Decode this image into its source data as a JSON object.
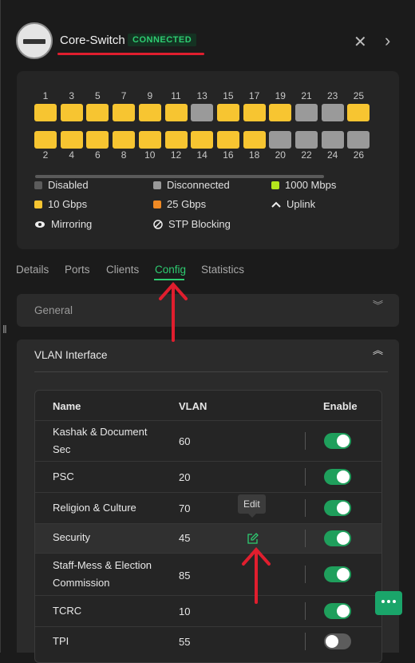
{
  "device": {
    "name": "Core-Switch",
    "status": "CONNECTED"
  },
  "ports": {
    "top_labels": [
      "1",
      "3",
      "5",
      "7",
      "9",
      "11",
      "13",
      "15",
      "17",
      "19",
      "21",
      "23",
      "25"
    ],
    "bottom_labels": [
      "2",
      "4",
      "6",
      "8",
      "10",
      "12",
      "14",
      "16",
      "18",
      "20",
      "22",
      "24",
      "26"
    ],
    "top_states": [
      "10g",
      "10g",
      "10g",
      "10g",
      "10g",
      "10g",
      "disconnected",
      "10g",
      "10g",
      "10g",
      "disconnected",
      "disconnected",
      "10g"
    ],
    "bottom_states": [
      "10g",
      "10g",
      "10g",
      "10g",
      "10g",
      "10g",
      "10g",
      "10g",
      "10g",
      "disconnected",
      "disconnected",
      "disconnected",
      "disconnected"
    ]
  },
  "legend": {
    "disabled": "Disabled",
    "disconnected": "Disconnected",
    "mbps1000": "1000 Mbps",
    "gbps10": "10 Gbps",
    "gbps25": "25 Gbps",
    "uplink": "Uplink",
    "mirroring": "Mirroring",
    "stp": "STP Blocking"
  },
  "tabs": [
    "Details",
    "Ports",
    "Clients",
    "Config",
    "Statistics"
  ],
  "active_tab": "Config",
  "sections": {
    "general": "General",
    "vlan": "VLAN Interface"
  },
  "table": {
    "headers": {
      "name": "Name",
      "vlan": "VLAN",
      "enable": "Enable"
    },
    "rows": [
      {
        "name": "Kashak & Document Sec",
        "vlan": "60",
        "enabled": true
      },
      {
        "name": "PSC",
        "vlan": "20",
        "enabled": true
      },
      {
        "name": "Religion & Culture",
        "vlan": "70",
        "enabled": true
      },
      {
        "name": "Security",
        "vlan": "45",
        "enabled": true
      },
      {
        "name": "Staff-Mess & Election Commission",
        "vlan": "85",
        "enabled": true
      },
      {
        "name": "TCRC",
        "vlan": "10",
        "enabled": true
      },
      {
        "name": "TPI",
        "vlan": "55",
        "enabled": false
      }
    ]
  },
  "tooltip": "Edit",
  "colors": {
    "accent": "#2ecc71",
    "port_10g": "#f7c531",
    "port_disconnected": "#9a9a9a",
    "port_25g": "#f08a24",
    "port_1000": "#b5e61d",
    "annotation": "#e01e2e"
  }
}
